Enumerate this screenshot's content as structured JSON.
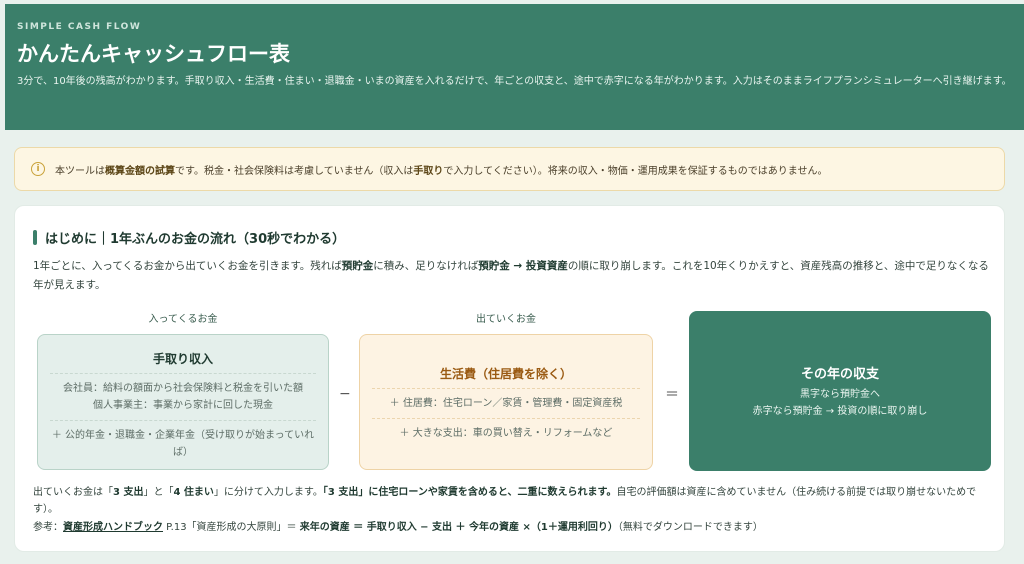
{
  "header": {
    "eyebrow": "SIMPLE CASH FLOW",
    "title": "かんたんキャッシュフロー表",
    "lead": "3分で、10年後の残高がわかります。手取り収入・生活費・住まい・退職金・いまの資産を入れるだけで、年ごとの収支と、途中で赤字になる年がわかります。入力はそのままライフプランシミュレーターへ引き継げます。"
  },
  "notice": {
    "icon": "info-icon",
    "pre": "本ツールは",
    "bold1": "概算金額の試算",
    "mid": "です。税金・社会保険料は考慮していません（収入は",
    "bold2": "手取り",
    "post": "で入力してください）。将来の収入・物価・運用成果を保証するものではありません。"
  },
  "intro": {
    "title": "はじめに｜1年ぶんのお金の流れ（30秒でわかる）",
    "p1": "1年ごとに、入ってくるお金から出ていくお金を引きます。残れば",
    "b1": "預貯金",
    "p2": "に積み、足りなければ",
    "b2": "預貯金 → 投資資産",
    "p3": "の順に取り崩します。これを10年くりかえすと、資産残高の推移と、途中で足りなくなる年が見えます。"
  },
  "flow": {
    "in_label": "入ってくるお金",
    "out_label": "出ていくお金",
    "in_title": "手取り収入",
    "in_line1": "会社員：給料の額面から社会保険料と税金を引いた額",
    "in_line2": "個人事業主：事業から家計に回した現金",
    "in_line3": "＋ 公的年金・退職金・企業年金（受け取りが始まっていれば）",
    "minus": "−",
    "out_title": "生活費（住居費を除く）",
    "out_line1": "＋ 住居費：住宅ローン／家賃・管理費・固定資産税",
    "out_line2": "＋ 大きな支出：車の買い替え・リフォームなど",
    "equals": "＝",
    "res_title": "その年の収支",
    "res_line1": "黒字なら預貯金へ",
    "res_line2": "赤字なら預貯金 → 投資の順に取り崩し"
  },
  "footer": {
    "f1": "出ていくお金は「",
    "fb1": "3 支出",
    "f2": "」と「",
    "fb2": "4 住まい",
    "f3": "」に分けて入力します。",
    "fb3": "「3 支出」に住宅ローンや家賃を含めると、二重に数えられます。",
    "f4": "自宅の評価額は資産に含めていません（住み続ける前提では取り崩せないためです）。",
    "ref_pre": "参考：",
    "ref_link": "資産形成ハンドブック",
    "ref_mid": " P.13「資産形成の大原則」＝ ",
    "ref_formula": "来年の資産 ＝ 手取り収入 − 支出 ＋ 今年の資産 ×（1＋運用利回り）",
    "ref_post": "（無料でダウンロードできます）"
  }
}
